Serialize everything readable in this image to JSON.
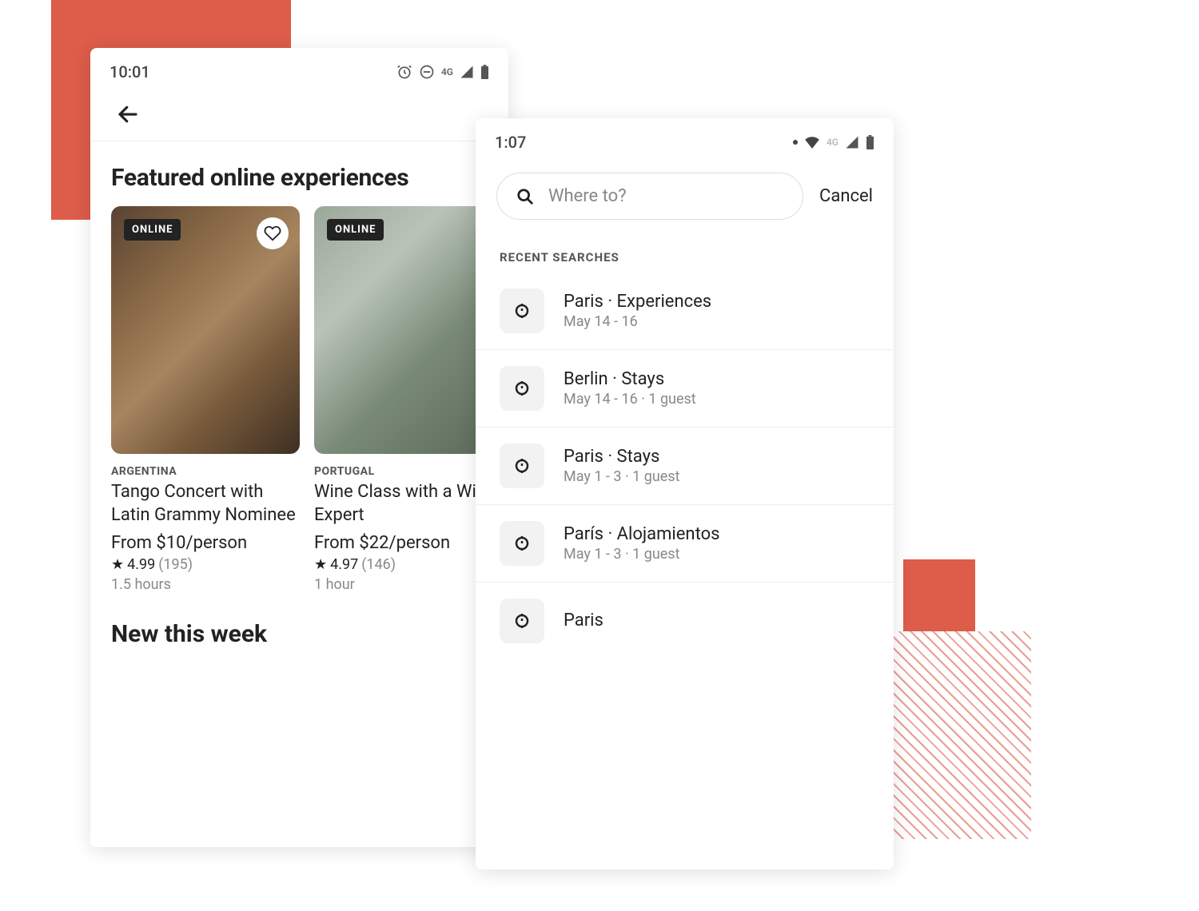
{
  "phone1": {
    "status": {
      "time": "10:01",
      "network": "4G"
    },
    "featured_title": "Featured online experiences",
    "new_title": "New this week",
    "cards": [
      {
        "badge": "ONLINE",
        "country": "ARGENTINA",
        "title": "Tango Concert with Latin Grammy Nominee",
        "price": "From $10/person",
        "rating": "4.99",
        "rating_count": "(195)",
        "duration": "1.5 hours"
      },
      {
        "badge": "ONLINE",
        "country": "PORTUGAL",
        "title": "Wine Class with a Wine Expert",
        "price": "From $22/person",
        "rating": "4.97",
        "rating_count": "(146)",
        "duration": "1 hour"
      }
    ]
  },
  "phone2": {
    "status": {
      "time": "1:07",
      "network": "4G"
    },
    "search": {
      "placeholder": "Where to?",
      "cancel": "Cancel"
    },
    "recent_label": "RECENT SEARCHES",
    "recent": [
      {
        "title": "Paris · Experiences",
        "sub": "May 14 - 16"
      },
      {
        "title": "Berlin · Stays",
        "sub": "May 14 - 16 · 1 guest"
      },
      {
        "title": "Paris · Stays",
        "sub": "May 1 - 3 · 1 guest"
      },
      {
        "title": "París · Alojamientos",
        "sub": "May 1 - 3 · 1 guest"
      },
      {
        "title": "Paris",
        "sub": ""
      }
    ]
  }
}
